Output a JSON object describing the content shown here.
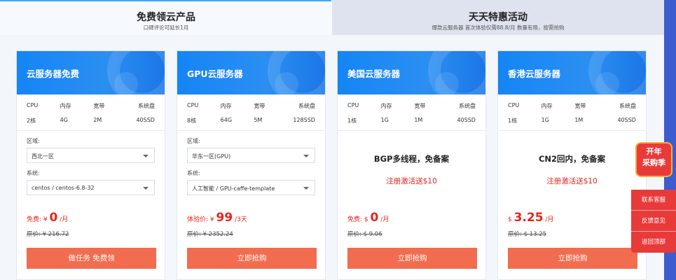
{
  "tabs": [
    {
      "title": "免费领云产品",
      "subtitle": "口碑评论可延长1月"
    },
    {
      "title": "天天特惠活动",
      "subtitle": "爆款云服务器 首次体验仅需88.8/月 数量有限，按需抢购"
    }
  ],
  "spec_headers": [
    "CPU",
    "内存",
    "宽带",
    "系统盘"
  ],
  "cards": [
    {
      "title": "云服务器免费",
      "specs": [
        "2核",
        "4G",
        "2M",
        "40SSD"
      ],
      "region_label": "区域:",
      "region_value": "西北一区",
      "system_label": "系统:",
      "system_value": "centos / centos-6.8-32",
      "price_prefix": "免费: ¥",
      "price": "0",
      "price_unit": "/月",
      "original": "原价: ¥ 216.72",
      "button": "做任务 免费领"
    },
    {
      "title": "GPU云服务器",
      "specs": [
        "8核",
        "64G",
        "5M",
        "128SSD"
      ],
      "region_label": "区域:",
      "region_value": "华东一区(GPU)",
      "system_label": "系统:",
      "system_value": "人工智能 / GPU-caffe-template",
      "price_prefix": "体验价: ¥",
      "price": "99",
      "price_unit": "/3天",
      "original": "原价: ¥ 2352.24",
      "button": "立即抢购"
    },
    {
      "title": "美国云服务器",
      "specs": [
        "1核",
        "1G",
        "1M",
        "40SSD"
      ],
      "feature": "BGP多线程，免备案",
      "promo": "注册激活送$10",
      "price_prefix": "免费: $",
      "price": "0",
      "price_unit": "/月",
      "original": "原价: $ 9.06",
      "button": "立即抢购"
    },
    {
      "title": "香港云服务器",
      "specs": [
        "1核",
        "1G",
        "1M",
        "40SSD"
      ],
      "feature": "CN2回内，免备案",
      "promo": "注册激活送$10",
      "price_prefix": "$",
      "price": "3.25",
      "price_unit": "/月",
      "original": "原价: $ 13.25",
      "button": "立即抢购"
    }
  ],
  "float": {
    "badge_line1": "开年",
    "badge_line2": "采购季",
    "links": [
      "联系客服",
      "反馈意见",
      "返回顶部"
    ]
  }
}
